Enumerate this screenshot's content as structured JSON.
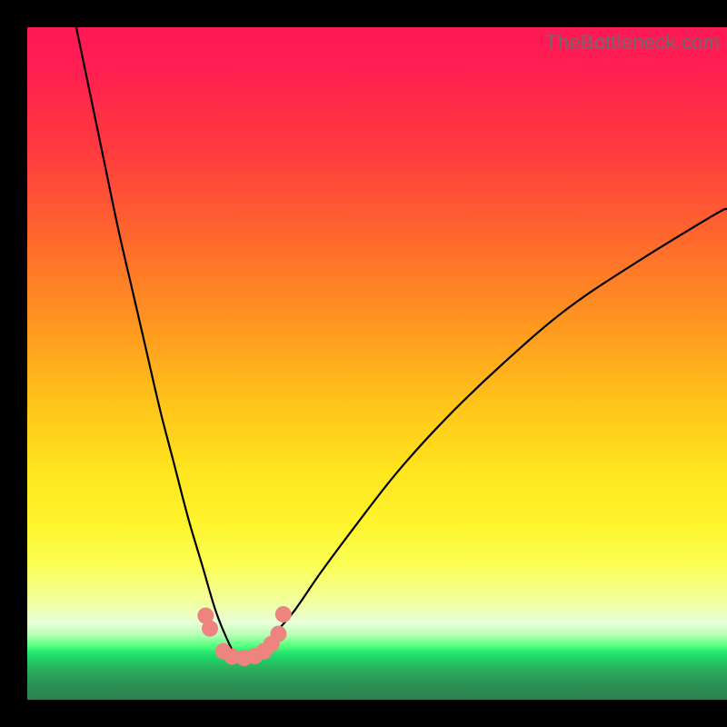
{
  "watermark": "TheBottleneck.com",
  "chart_data": {
    "type": "line",
    "title": "",
    "xlabel": "",
    "ylabel": "",
    "xlim": [
      0,
      100
    ],
    "ylim": [
      0,
      100
    ],
    "grid": false,
    "notes": "Background is a vertical rainbow gradient from red (high y) to green (low y). A black V-shaped curve dips to a minimum near x≈30 at the green band. Salmon-colored round markers sit along the curve near the trough.",
    "series": [
      {
        "name": "bottleneck-curve",
        "x": [
          7,
          9,
          11,
          13,
          15,
          17,
          19,
          21,
          23,
          25,
          27,
          29,
          30,
          31,
          33,
          35,
          38,
          42,
          47,
          53,
          60,
          68,
          77,
          87,
          98,
          100
        ],
        "y": [
          100,
          90,
          80,
          70,
          61,
          52,
          43,
          35,
          27,
          20,
          13,
          8,
          6.2,
          6.2,
          7.3,
          9.5,
          13,
          19,
          26,
          34,
          42,
          50,
          58,
          65,
          72,
          73
        ]
      }
    ],
    "markers": {
      "name": "highlight-points",
      "color": "#ed8480",
      "points": [
        {
          "x": 25.5,
          "y": 12.5
        },
        {
          "x": 26.1,
          "y": 10.6
        },
        {
          "x": 28.0,
          "y": 7.2
        },
        {
          "x": 29.3,
          "y": 6.4
        },
        {
          "x": 31.0,
          "y": 6.2
        },
        {
          "x": 32.5,
          "y": 6.5
        },
        {
          "x": 33.8,
          "y": 7.2
        },
        {
          "x": 34.9,
          "y": 8.3
        },
        {
          "x": 35.9,
          "y": 9.8
        },
        {
          "x": 36.6,
          "y": 12.7
        }
      ]
    },
    "gradient_stops": [
      {
        "pos": 0.0,
        "color": "#ff1856"
      },
      {
        "pos": 0.18,
        "color": "#ff3a3f"
      },
      {
        "pos": 0.45,
        "color": "#ff9a1f"
      },
      {
        "pos": 0.66,
        "color": "#ffe51e"
      },
      {
        "pos": 0.8,
        "color": "#fbff55"
      },
      {
        "pos": 0.905,
        "color": "#b8ffb8"
      },
      {
        "pos": 0.93,
        "color": "#28e86e"
      },
      {
        "pos": 1.0,
        "color": "#2d8250"
      }
    ]
  }
}
